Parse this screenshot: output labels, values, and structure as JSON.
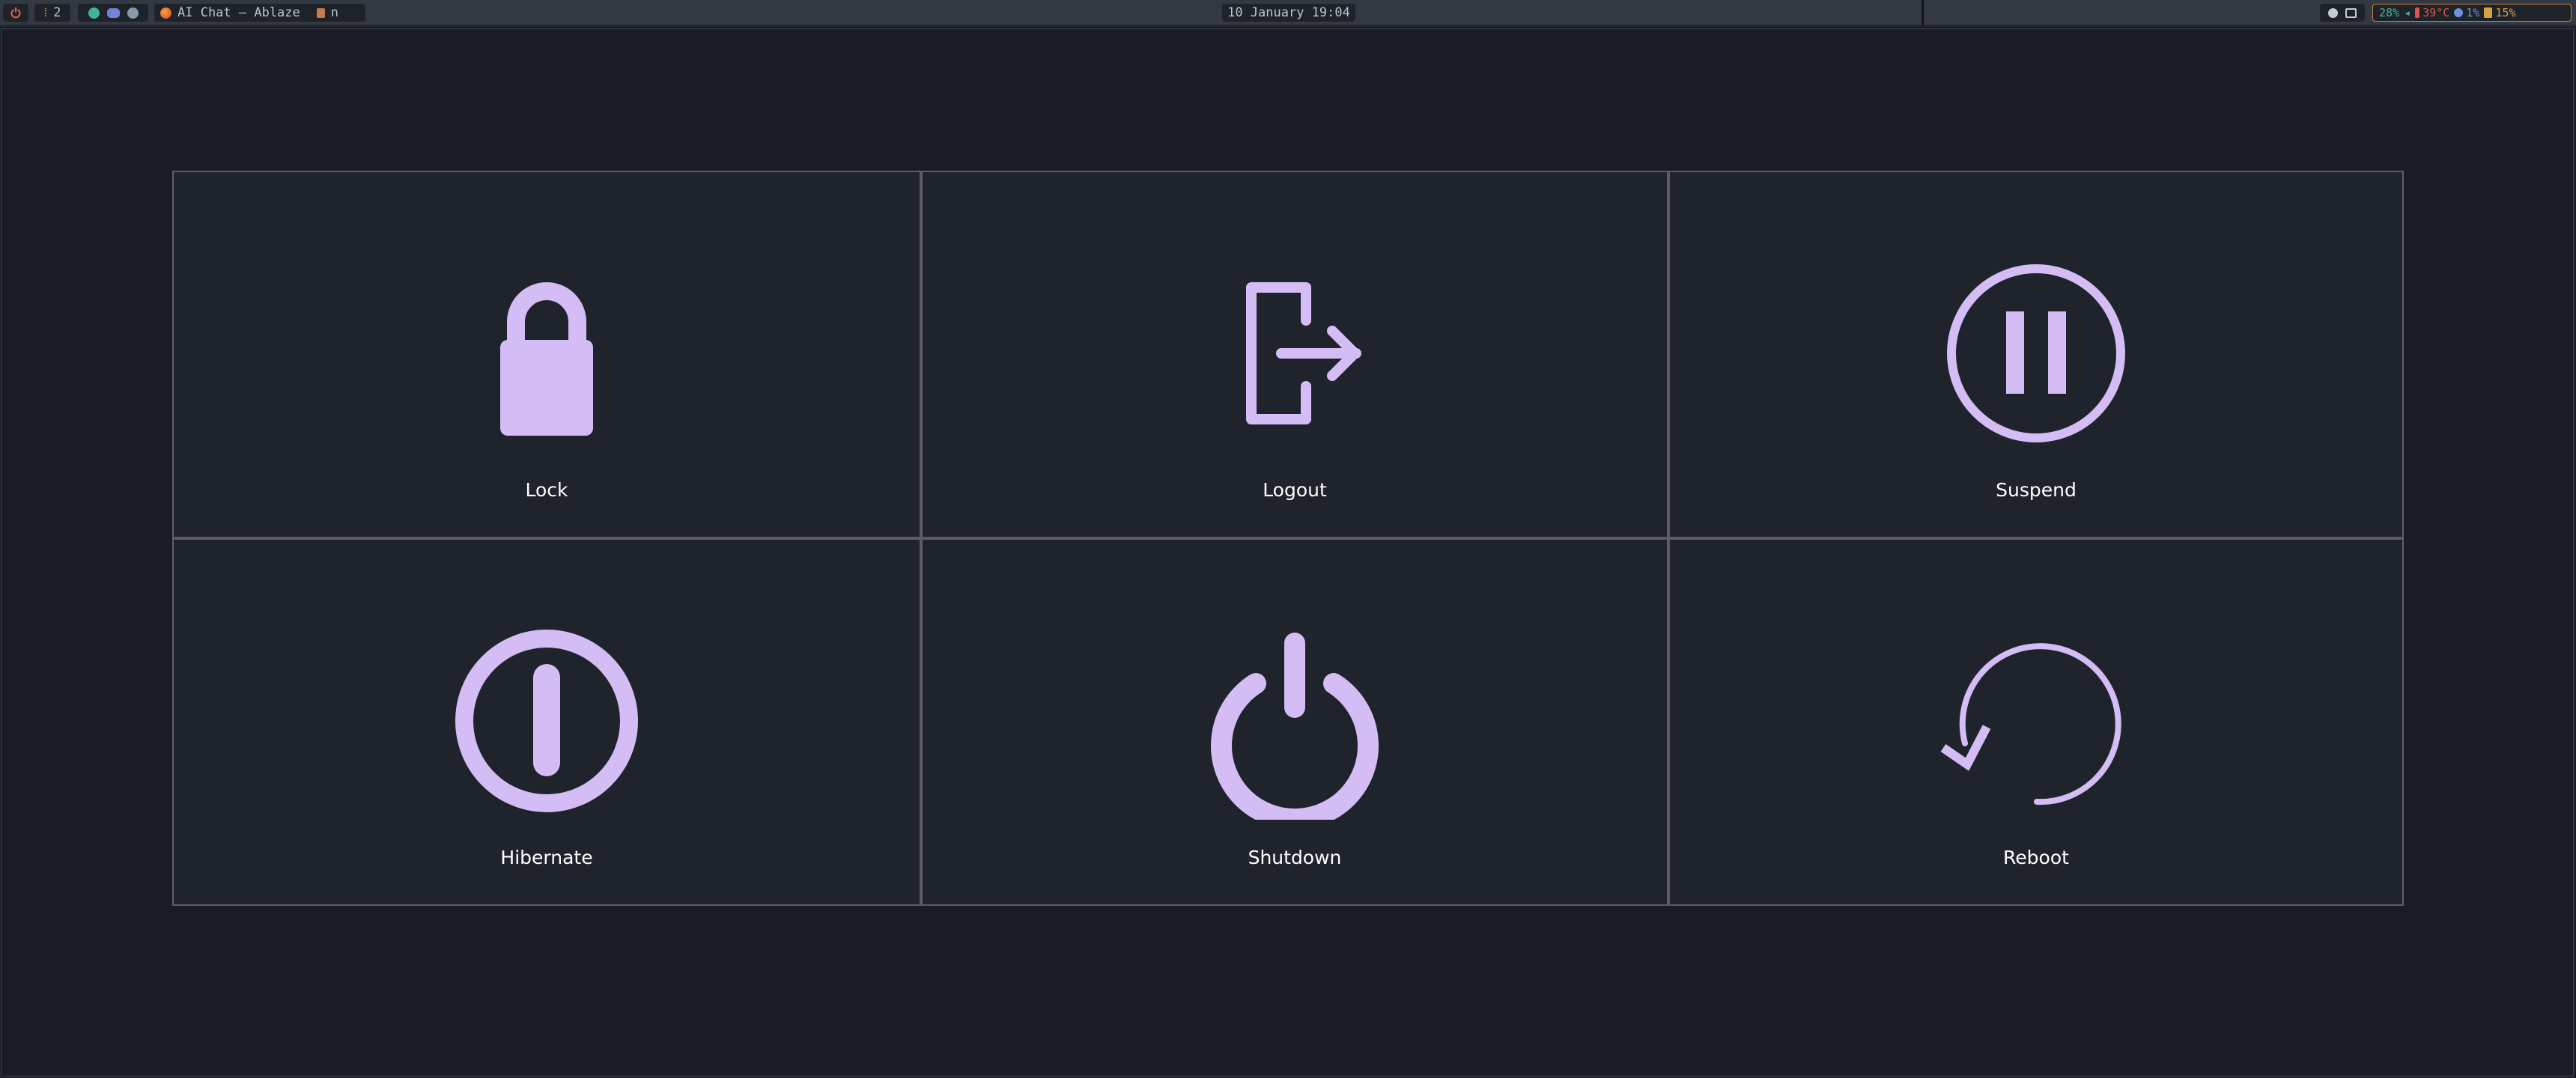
{
  "topbar": {
    "workspace": "2",
    "window_title": "AI Chat — Ablaze",
    "window_extra": "n",
    "clock": "10 January 19:04",
    "stats": {
      "cpu": "28%",
      "temp": "39°C",
      "mem": "1%",
      "battery": "15%"
    }
  },
  "menu": {
    "accent": "#d4bdf5",
    "items": [
      {
        "label": "Lock",
        "icon": "lock-icon"
      },
      {
        "label": "Logout",
        "icon": "logout-icon"
      },
      {
        "label": "Suspend",
        "icon": "pause-circle-icon"
      },
      {
        "label": "Hibernate",
        "icon": "hibernate-icon"
      },
      {
        "label": "Shutdown",
        "icon": "power-icon"
      },
      {
        "label": "Reboot",
        "icon": "reboot-icon"
      }
    ]
  }
}
